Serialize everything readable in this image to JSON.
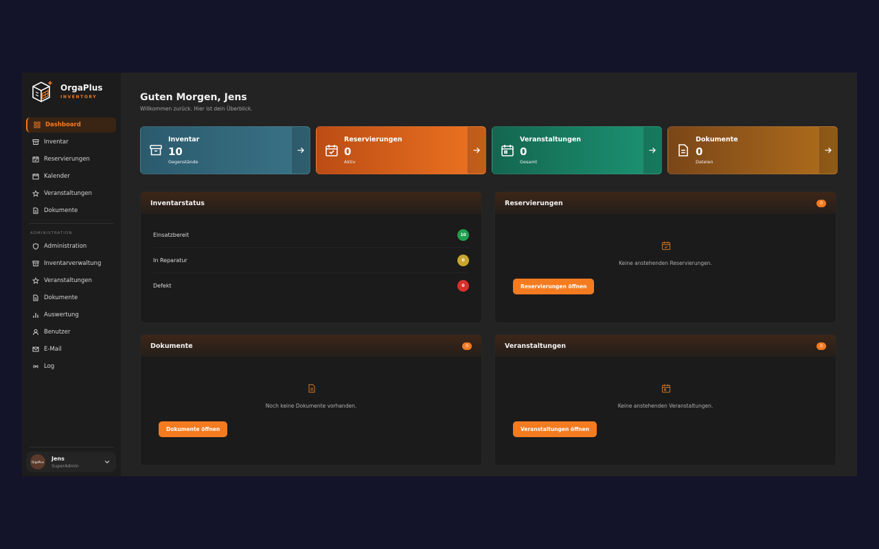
{
  "brand": {
    "name": "OrgaPlus",
    "subtitle": "INVENTORY"
  },
  "nav_main": [
    {
      "label": "Dashboard",
      "icon": "grid-icon",
      "active": true
    },
    {
      "label": "Inventar",
      "icon": "archive-icon"
    },
    {
      "label": "Reservierungen",
      "icon": "calendar-check-icon"
    },
    {
      "label": "Kalender",
      "icon": "calendar-icon"
    },
    {
      "label": "Veranstaltungen",
      "icon": "star-icon"
    },
    {
      "label": "Dokumente",
      "icon": "document-icon"
    }
  ],
  "admin_section_label": "ADMINISTRATION",
  "nav_admin": [
    {
      "label": "Administration",
      "icon": "shield-icon"
    },
    {
      "label": "Inventarverwaltung",
      "icon": "archive-icon"
    },
    {
      "label": "Veranstaltungen",
      "icon": "star-icon"
    },
    {
      "label": "Dokumente",
      "icon": "document-icon"
    },
    {
      "label": "Auswertung",
      "icon": "bar-chart-icon"
    },
    {
      "label": "Benutzer",
      "icon": "user-icon"
    },
    {
      "label": "E-Mail",
      "icon": "mail-icon"
    },
    {
      "label": "Log",
      "icon": "broadcast-icon"
    }
  ],
  "user": {
    "name": "Jens",
    "role": "SuperAdmin",
    "avatar_text": "OrgaPlus"
  },
  "header": {
    "greeting": "Guten Morgen, Jens",
    "subtitle": "Willkommen zurück. Hier ist dein Überblick."
  },
  "stats": [
    {
      "title": "Inventar",
      "value": "10",
      "sub": "Gegenstände",
      "icon": "archive-icon",
      "color": "#2e6a7c"
    },
    {
      "title": "Reservierungen",
      "value": "0",
      "sub": "Aktiv",
      "icon": "calendar-check-icon",
      "color": "#e0641c"
    },
    {
      "title": "Veranstaltungen",
      "value": "0",
      "sub": "Gesamt",
      "icon": "calendar-icon",
      "color": "#178a6a"
    },
    {
      "title": "Dokumente",
      "value": "0",
      "sub": "Dateien",
      "icon": "document-icon",
      "color": "#a8641a"
    }
  ],
  "inventory_status": {
    "title": "Inventarstatus",
    "rows": [
      {
        "label": "Einsatzbereit",
        "count": "10",
        "color": "#1fa04c"
      },
      {
        "label": "In Reparatur",
        "count": "0",
        "color": "#c9a62a"
      },
      {
        "label": "Defekt",
        "count": "0",
        "color": "#d9302c"
      }
    ]
  },
  "reservations_panel": {
    "title": "Reservierungen",
    "badge": "0",
    "empty": "Keine anstehenden Reservierungen.",
    "button": "Reservierungen öffnen"
  },
  "documents_panel": {
    "title": "Dokumente",
    "badge": "0",
    "empty": "Noch keine Dokumente vorhanden.",
    "button": "Dokumente öffnen"
  },
  "events_panel": {
    "title": "Veranstaltungen",
    "badge": "0",
    "empty": "Keine anstehenden Veranstaltungen.",
    "button": "Veranstaltungen öffnen"
  },
  "colors": {
    "accent": "#f47b20",
    "background": "#13142a",
    "app": "#232323",
    "sidebar": "#1c1c1c"
  }
}
